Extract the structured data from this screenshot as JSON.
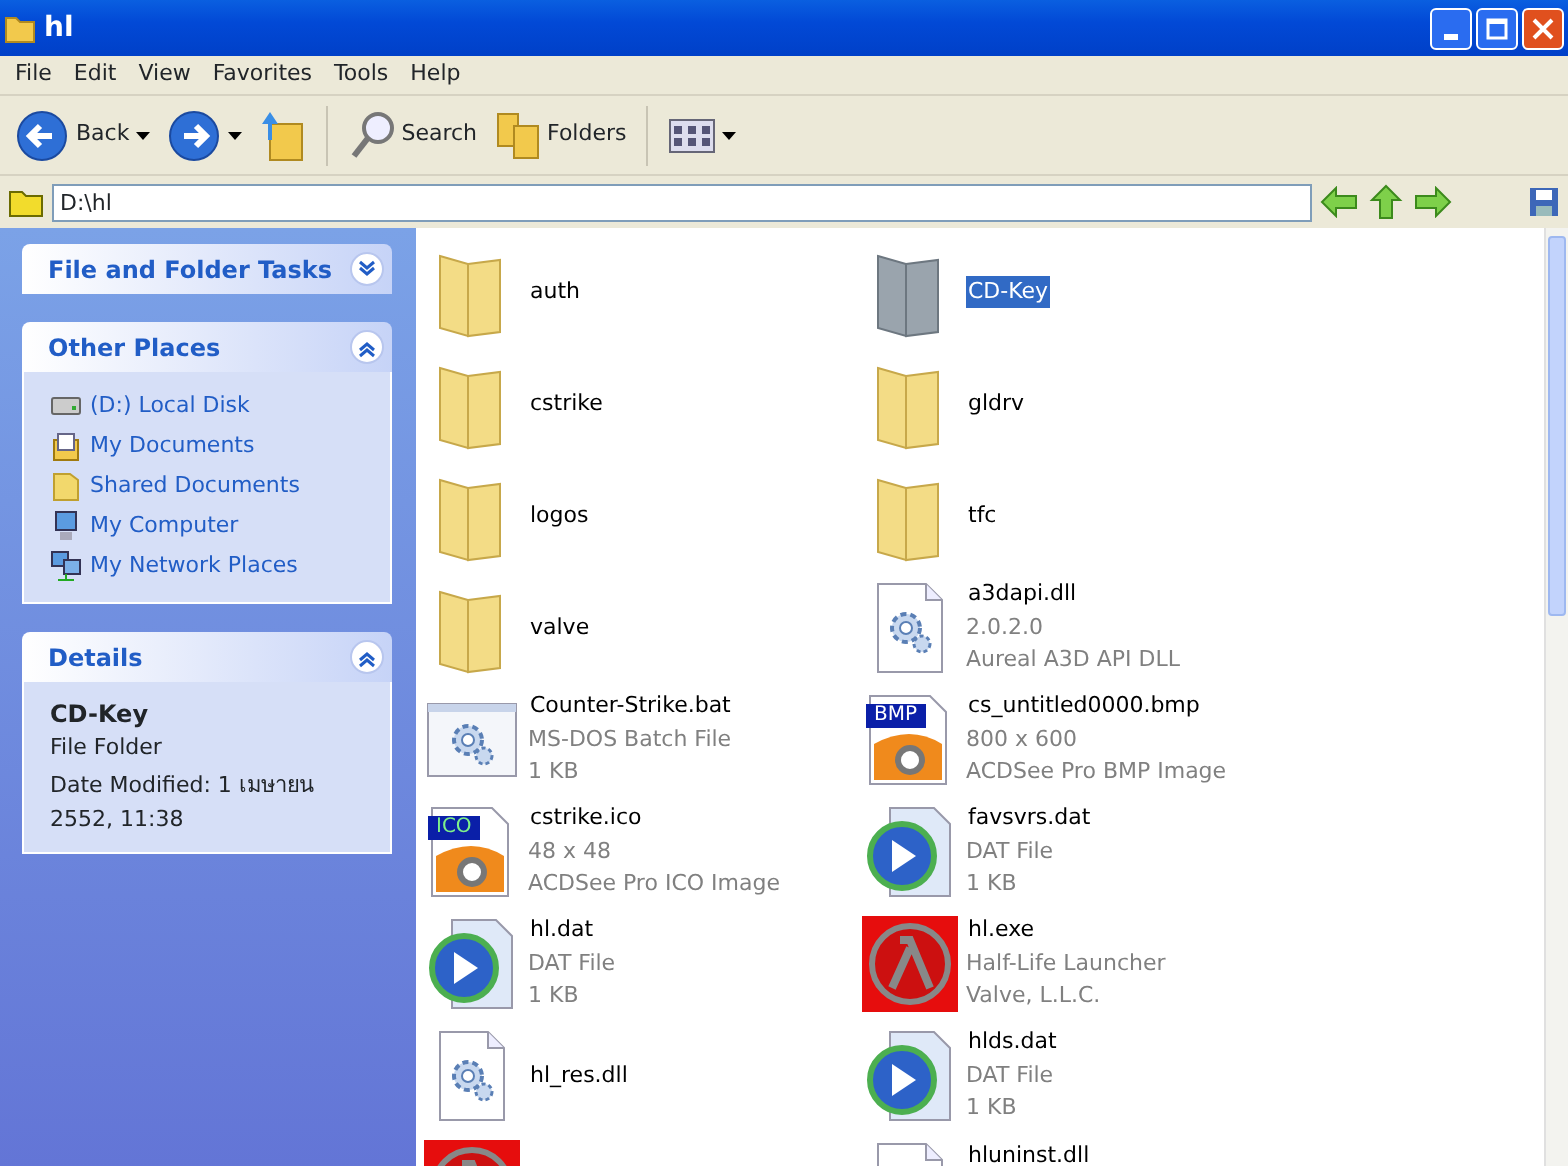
{
  "window": {
    "title": "hl"
  },
  "menu": [
    "File",
    "Edit",
    "View",
    "Favorites",
    "Tools",
    "Help"
  ],
  "toolbar": [
    {
      "kind": "back",
      "label": "Back"
    },
    {
      "kind": "forward"
    },
    {
      "kind": "up"
    },
    {
      "kind": "search",
      "label": "Search"
    },
    {
      "kind": "folders",
      "label": "Folders"
    },
    {
      "kind": "views"
    }
  ],
  "address": {
    "value": "D:\\hl"
  },
  "sidebar": [
    {
      "title": "File and Folder Tasks",
      "expanded": false,
      "kind": "tasks"
    },
    {
      "title": "Other Places",
      "expanded": true,
      "kind": "places",
      "items": [
        {
          "kind": "disk",
          "label": "(D:) Local Disk"
        },
        {
          "kind": "docs",
          "label": "My Documents"
        },
        {
          "kind": "shared",
          "label": "Shared Documents"
        },
        {
          "kind": "computer",
          "label": "My Computer"
        },
        {
          "kind": "network",
          "label": "My Network Places"
        }
      ]
    },
    {
      "title": "Details",
      "expanded": true,
      "kind": "details",
      "name": "CD-Key",
      "type": "File Folder",
      "date": "Date Modified: 1 เมษายน 2552, 11:38"
    }
  ],
  "files": [
    {
      "kind": "folder",
      "name": "auth",
      "selected": false
    },
    {
      "kind": "folder",
      "name": "CD-Key",
      "selected": true
    },
    {
      "kind": "folder",
      "name": "cstrike",
      "selected": false
    },
    {
      "kind": "folder",
      "name": "gldrv",
      "selected": false
    },
    {
      "kind": "folder",
      "name": "logos",
      "selected": false
    },
    {
      "kind": "folder",
      "name": "tfc",
      "selected": false
    },
    {
      "kind": "folder",
      "name": "valve",
      "selected": false
    },
    {
      "kind": "dll",
      "name": "a3dapi.dll",
      "lines": [
        "2.0.2.0",
        "Aureal A3D API DLL"
      ],
      "selected": false
    },
    {
      "kind": "bat",
      "name": "Counter-Strike.bat",
      "lines": [
        "MS-DOS Batch File",
        "1 KB"
      ],
      "selected": false
    },
    {
      "kind": "image",
      "badge": "BMP",
      "name": "cs_untitled0000.bmp",
      "lines": [
        "800 x 600",
        "ACDSee Pro BMP Image"
      ],
      "selected": false
    },
    {
      "kind": "image",
      "badge": "ICO",
      "name": "cstrike.ico",
      "lines": [
        "48 x 48",
        "ACDSee Pro ICO Image"
      ],
      "selected": false
    },
    {
      "kind": "dat",
      "name": "favsvrs.dat",
      "lines": [
        "DAT File",
        "1 KB"
      ],
      "selected": false
    },
    {
      "kind": "dat",
      "name": "hl.dat",
      "lines": [
        "DAT File",
        "1 KB"
      ],
      "selected": false
    },
    {
      "kind": "exe",
      "name": "hl.exe",
      "lines": [
        "Half-Life Launcher",
        "Valve, L.L.C."
      ],
      "selected": false
    },
    {
      "kind": "dll",
      "name": "hl_res.dll",
      "selected": false
    },
    {
      "kind": "dat",
      "name": "hlds.dat",
      "lines": [
        "DAT File",
        "1 KB"
      ],
      "selected": false
    },
    {
      "kind": "exe",
      "clipped": true,
      "selected": false
    },
    {
      "kind": "dll",
      "name": "hluninst.dll",
      "clipped": true,
      "selected": false
    }
  ]
}
